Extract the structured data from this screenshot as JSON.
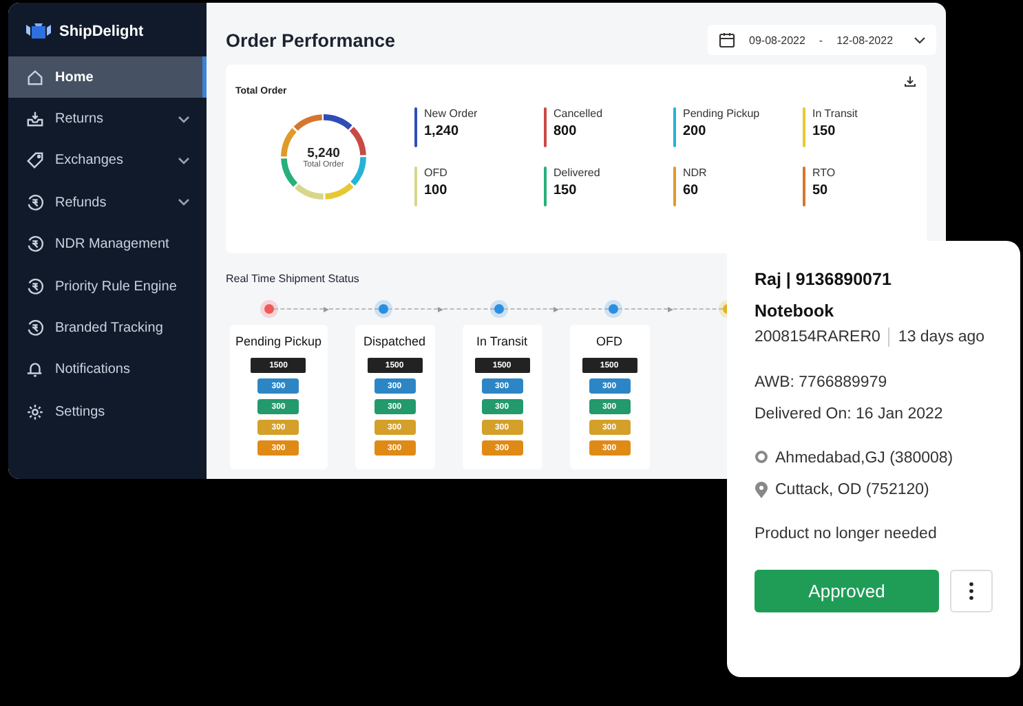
{
  "brand": {
    "name": "ShipDelight"
  },
  "sidebar": {
    "items": [
      {
        "kind": "home",
        "label": "Home",
        "selected": true,
        "has_submenu": false
      },
      {
        "kind": "tray",
        "label": "Returns",
        "selected": false,
        "has_submenu": true
      },
      {
        "kind": "tag",
        "label": "Exchanges",
        "selected": false,
        "has_submenu": true
      },
      {
        "kind": "rupee",
        "label": "Refunds",
        "selected": false,
        "has_submenu": true
      },
      {
        "kind": "rupee",
        "label": "NDR Management",
        "selected": false,
        "has_submenu": false
      },
      {
        "kind": "rupee",
        "label": "Priority Rule Engine",
        "selected": false,
        "has_submenu": false
      },
      {
        "kind": "rupee",
        "label": "Branded Tracking",
        "selected": false,
        "has_submenu": false
      },
      {
        "kind": "bell",
        "label": "Notifications",
        "selected": false,
        "has_submenu": false
      },
      {
        "kind": "gear",
        "label": "Settings",
        "selected": false,
        "has_submenu": false
      }
    ]
  },
  "header": {
    "title": "Order Performance",
    "date_range": {
      "start": "09-08-2022",
      "separator": "-",
      "end": "12-08-2022"
    }
  },
  "total_order": {
    "title": "Total Order",
    "total": "5,240",
    "total_label": "Total Order",
    "stats": [
      {
        "label": "New Order",
        "value": "1,240",
        "color": "#2f4db5"
      },
      {
        "label": "Cancelled",
        "value": "800",
        "color": "#c94a45"
      },
      {
        "label": "Pending Pickup",
        "value": "200",
        "color": "#25b3d6"
      },
      {
        "label": "In Transit",
        "value": "150",
        "color": "#e8c832"
      },
      {
        "label": "OFD",
        "value": "100",
        "color": "#d8d68a"
      },
      {
        "label": "Delivered",
        "value": "150",
        "color": "#27b07a"
      },
      {
        "label": "NDR",
        "value": "60",
        "color": "#e09a2c"
      },
      {
        "label": "RTO",
        "value": "50",
        "color": "#d5762f"
      }
    ]
  },
  "shipment_status": {
    "title": "Real Time Shipment Status",
    "timeline": [
      {
        "color": "#ef5a5a"
      },
      {
        "color": "#2b8fe0"
      },
      {
        "color": "#2b8fe0"
      },
      {
        "color": "#2b8fe0"
      },
      {
        "color": "#e3b31e"
      }
    ],
    "columns": [
      {
        "label": "Pending Pickup",
        "badges": [
          {
            "value": "1500",
            "color": "#222222"
          },
          {
            "value": "300",
            "color": "#2c86c6"
          },
          {
            "value": "300",
            "color": "#239a6c"
          },
          {
            "value": "300",
            "color": "#d4a02a"
          },
          {
            "value": "300",
            "color": "#e08a16"
          }
        ]
      },
      {
        "label": "Dispatched",
        "badges": [
          {
            "value": "1500",
            "color": "#222222"
          },
          {
            "value": "300",
            "color": "#2c86c6"
          },
          {
            "value": "300",
            "color": "#239a6c"
          },
          {
            "value": "300",
            "color": "#d4a02a"
          },
          {
            "value": "300",
            "color": "#e08a16"
          }
        ]
      },
      {
        "label": "In Transit",
        "badges": [
          {
            "value": "1500",
            "color": "#222222"
          },
          {
            "value": "300",
            "color": "#2c86c6"
          },
          {
            "value": "300",
            "color": "#239a6c"
          },
          {
            "value": "300",
            "color": "#d4a02a"
          },
          {
            "value": "300",
            "color": "#e08a16"
          }
        ]
      },
      {
        "label": "OFD",
        "badges": [
          {
            "value": "1500",
            "color": "#222222"
          },
          {
            "value": "300",
            "color": "#2c86c6"
          },
          {
            "value": "300",
            "color": "#239a6c"
          },
          {
            "value": "300",
            "color": "#d4a02a"
          },
          {
            "value": "300",
            "color": "#e08a16"
          }
        ]
      }
    ]
  },
  "order_card": {
    "customer": "Raj | 9136890071",
    "product": "Notebook",
    "order_id": "2008154RARER0",
    "age": "13 days ago",
    "awb": "AWB: 7766889979",
    "delivered": "Delivered On: 16 Jan 2022",
    "from": "Ahmedabad,GJ (380008)",
    "to": "Cuttack, OD (752120)",
    "reason": "Product no longer needed",
    "action": "Approved"
  }
}
